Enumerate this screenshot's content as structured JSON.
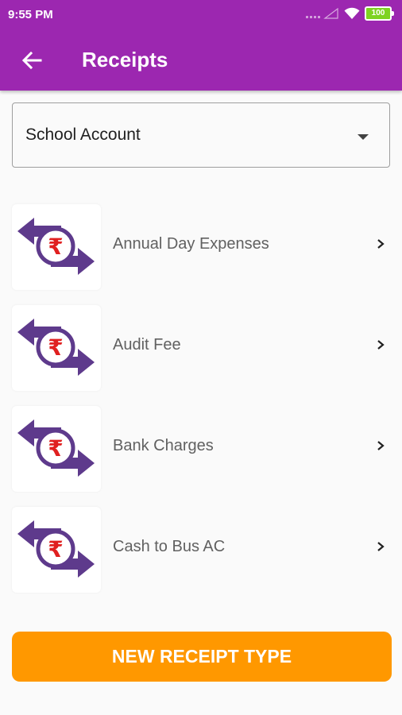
{
  "status_bar": {
    "time": "9:55 PM",
    "battery": "100"
  },
  "app_bar": {
    "title": "Receipts",
    "color": "#9c27b0"
  },
  "account_selector": {
    "value": "School Account"
  },
  "receipt_types": [
    {
      "label": "Annual Day Expenses",
      "icon": "rupee-transfer-icon"
    },
    {
      "label": "Audit Fee",
      "icon": "rupee-transfer-icon"
    },
    {
      "label": "Bank Charges",
      "icon": "rupee-transfer-icon"
    },
    {
      "label": "Cash to Bus AC",
      "icon": "rupee-transfer-icon"
    }
  ],
  "new_button": {
    "label": "NEW RECEIPT TYPE",
    "color": "#ff9800"
  },
  "colors": {
    "icon_purple": "#5e3a8c",
    "icon_red": "#e02020"
  }
}
